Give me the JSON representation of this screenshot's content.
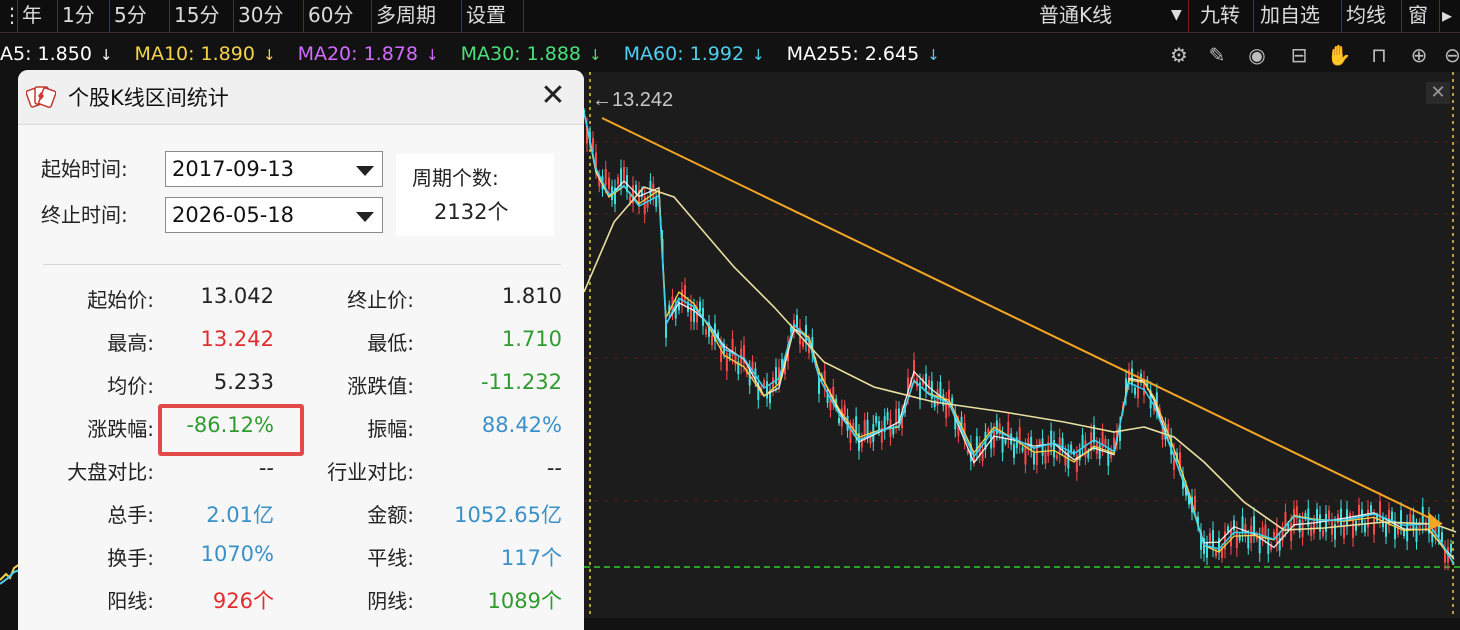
{
  "toolbar": {
    "items": [
      "年",
      "1分",
      "5分",
      "15分",
      "30分",
      "60分",
      "多周期",
      "设置"
    ],
    "right_items": [
      "普通K线",
      "九转",
      "加自选",
      "均线",
      "窗"
    ]
  },
  "ma_row": {
    "ma5": "A5: 1.850",
    "ma10": "MA10: 1.890",
    "ma20": "MA20: 1.878",
    "ma30": "MA30: 1.888",
    "ma60": "MA60: 1.992",
    "ma255": "MA255: 2.645",
    "colors": {
      "ma5": "#ffffff",
      "ma10": "#f5d34a",
      "ma20": "#d36bff",
      "ma30": "#49e07a",
      "ma60": "#4fd0f0",
      "ma255": "#ffffff"
    }
  },
  "tools": [
    "settings-icon",
    "pen-icon",
    "eye-icon",
    "toolbox-icon",
    "hand-icon",
    "lock-icon",
    "zoom-in-icon",
    "zoom-out-icon"
  ],
  "chart": {
    "max_label": "←13.242",
    "close_glyph": "✕"
  },
  "dialog": {
    "title": "个股K线区间统计",
    "close_glyph": "✕",
    "start_label": "起始时间:",
    "end_label": "终止时间:",
    "start_date": "2017-09-13",
    "end_date": "2026-05-18",
    "period_label": "周期个数:",
    "period_value": "2132个",
    "stats": [
      {
        "l1": "起始价:",
        "v1": "13.042",
        "c1": "dark",
        "l2": "终止价:",
        "v2": "1.810",
        "c2": "dark"
      },
      {
        "l1": "最高:",
        "v1": "13.242",
        "c1": "red",
        "l2": "最低:",
        "v2": "1.710",
        "c2": "green"
      },
      {
        "l1": "均价:",
        "v1": "5.233",
        "c1": "dark",
        "l2": "涨跌值:",
        "v2": "-11.232",
        "c2": "green"
      },
      {
        "l1": "涨跌幅:",
        "v1": "-86.12%",
        "c1": "green",
        "l2": "振幅:",
        "v2": "88.42%",
        "c2": "blue"
      },
      {
        "l1": "大盘对比:",
        "v1": "--",
        "c1": "dark",
        "l2": "行业对比:",
        "v2": "--",
        "c2": "dark"
      },
      {
        "l1": "总手:",
        "v1": "2.01亿",
        "c1": "blue",
        "l2": "金额:",
        "v2": "1052.65亿",
        "c2": "blue"
      },
      {
        "l1": "换手:",
        "v1": "1070%",
        "c1": "blue",
        "l2": "平线:",
        "v2": "117个",
        "c2": "blue"
      },
      {
        "l1": "阳线:",
        "v1": "926个",
        "c1": "red",
        "l2": "阴线:",
        "v2": "1089个",
        "c2": "green"
      }
    ]
  }
}
